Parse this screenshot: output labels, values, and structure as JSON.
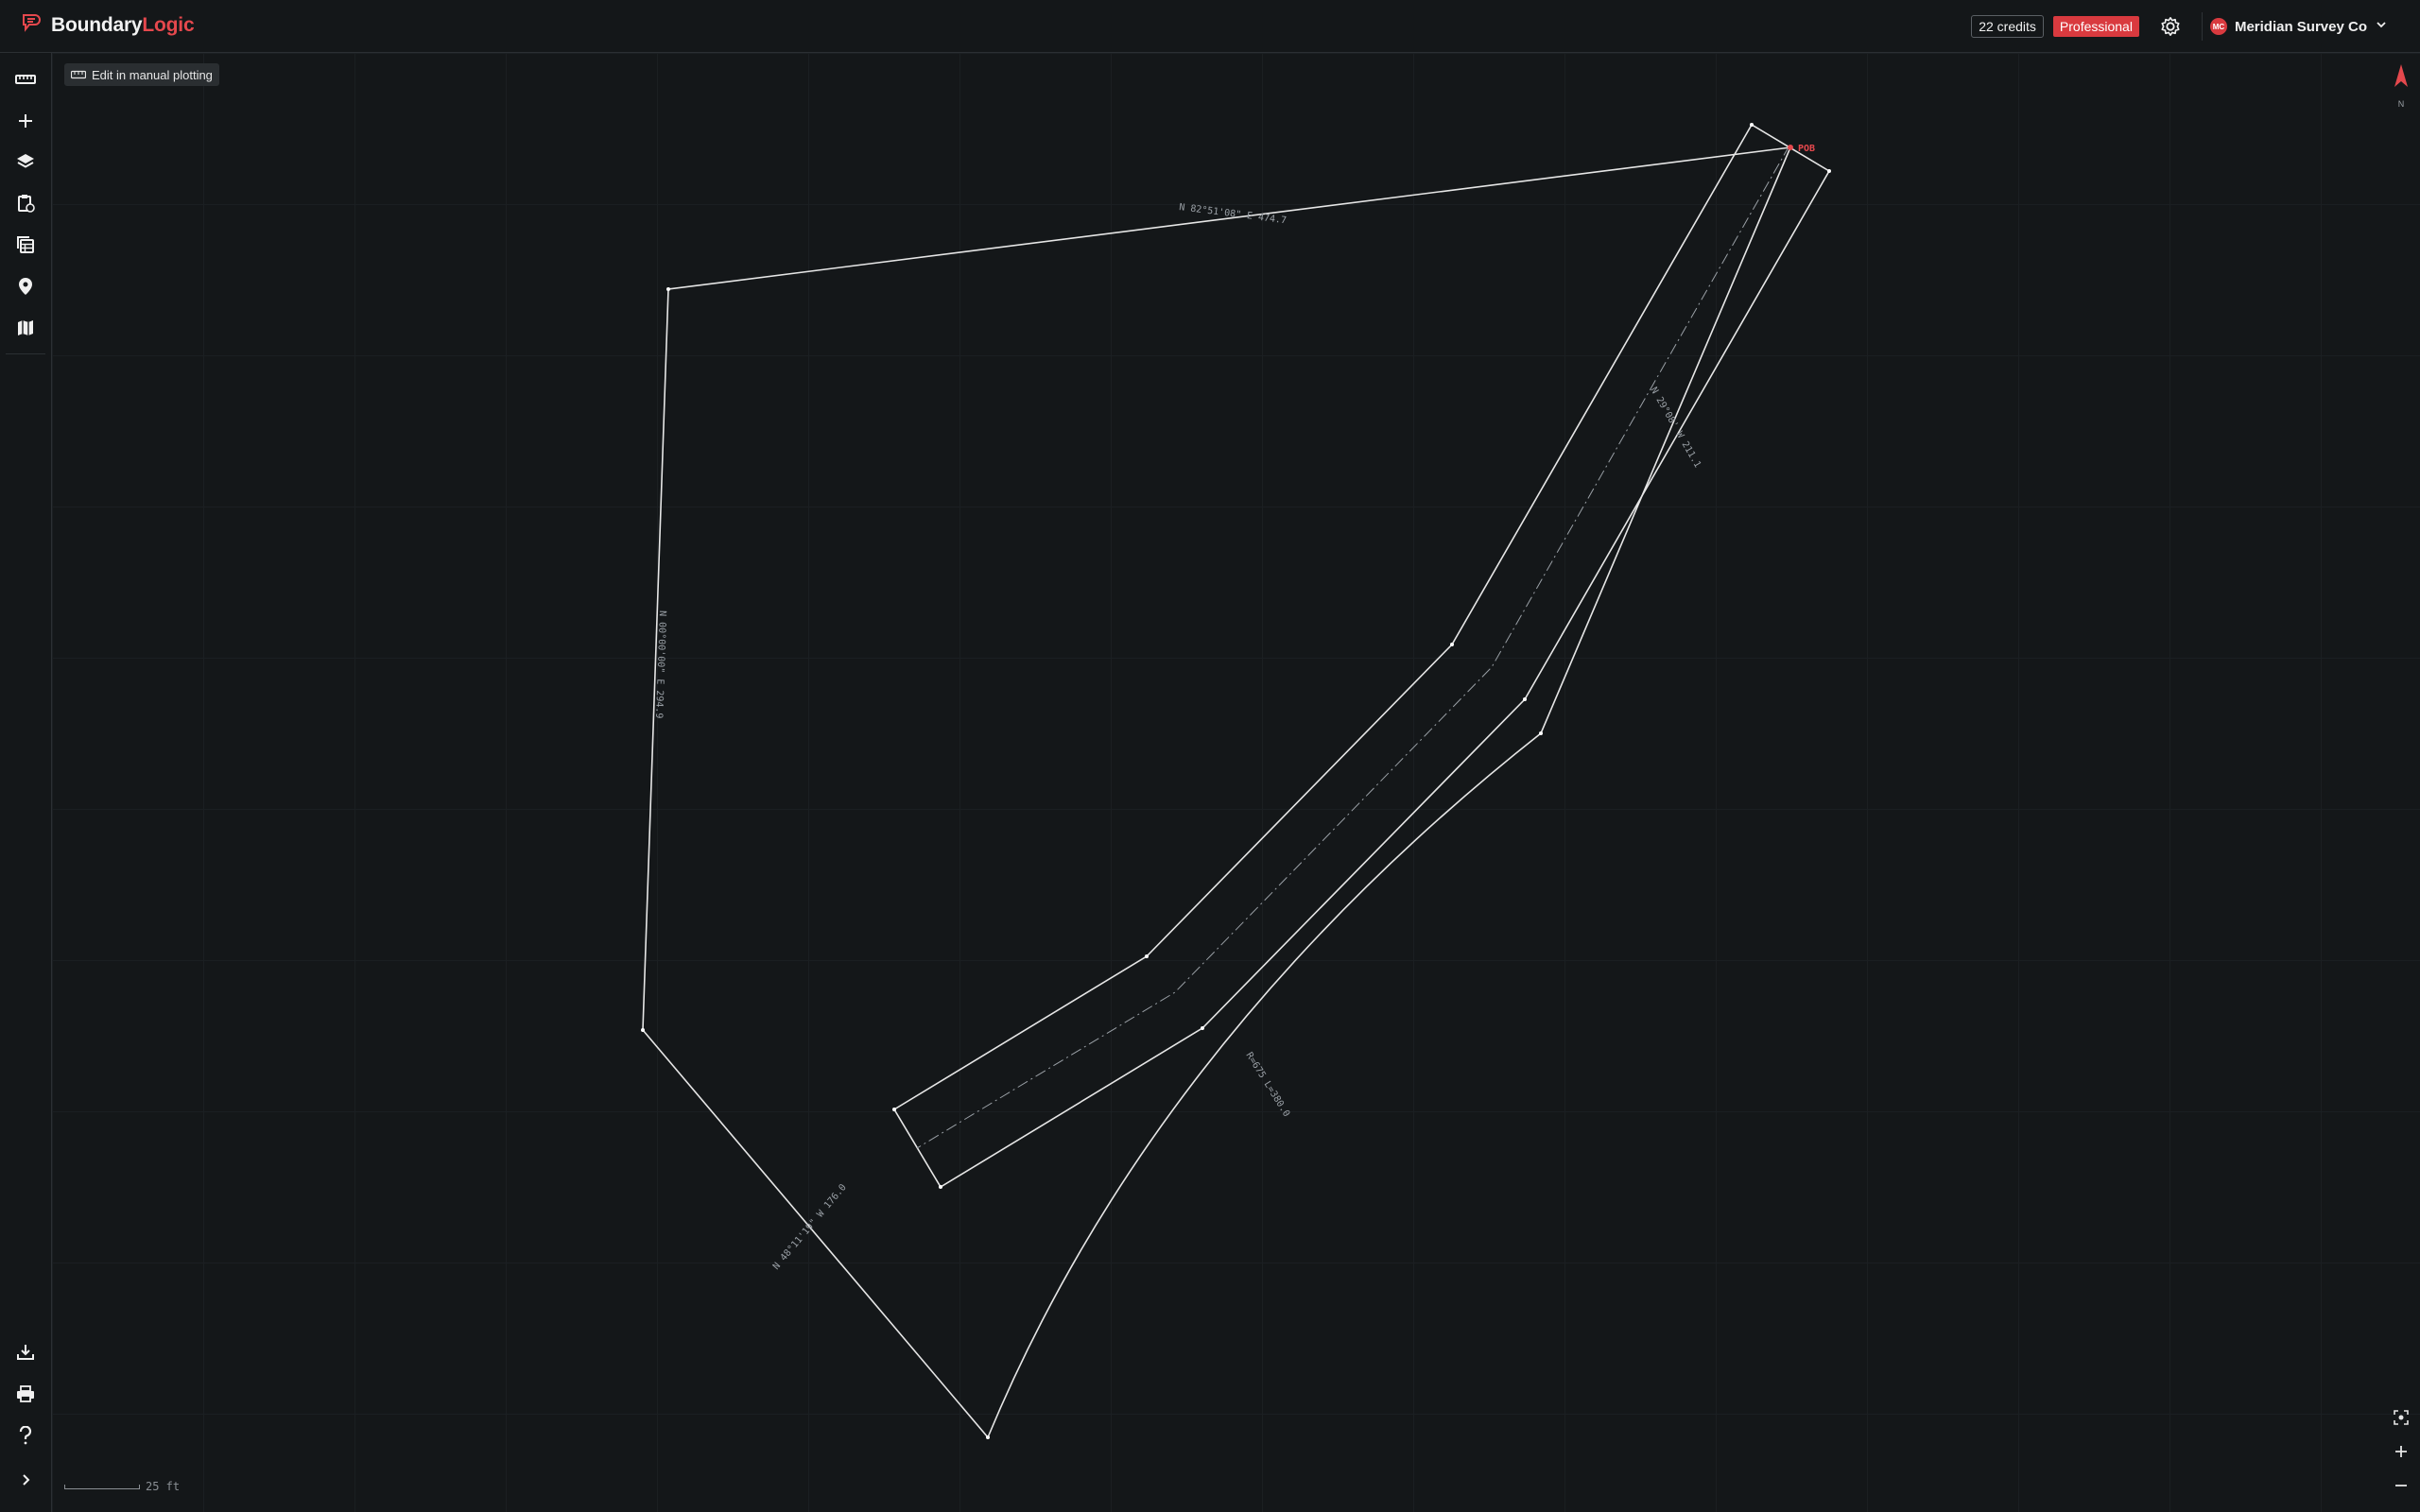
{
  "app": {
    "brand_part1": "Boundary",
    "brand_part2": "Logic"
  },
  "header": {
    "credits": "22 credits",
    "plan": "Professional",
    "account_initials": "MC",
    "account_name": "Meridian Survey Co"
  },
  "toolbar": {
    "edit_manual": "Edit in manual plotting"
  },
  "plot": {
    "pob_label": "POB",
    "labels": {
      "north_line": "N 82°51'08\" E 474.7",
      "east_line": "N 29°08' W 211.1",
      "west_line": "N 00°00'00\" E 294.9",
      "curve": "R=675 L=380.0",
      "southwest_line": "N 48°11'19\" W 176.0"
    }
  },
  "compass": {
    "north_label": "N"
  },
  "scale": {
    "label": "25 ft"
  },
  "colors": {
    "accent": "#e5484d",
    "line": "#e6e6e6",
    "background": "#141719"
  }
}
